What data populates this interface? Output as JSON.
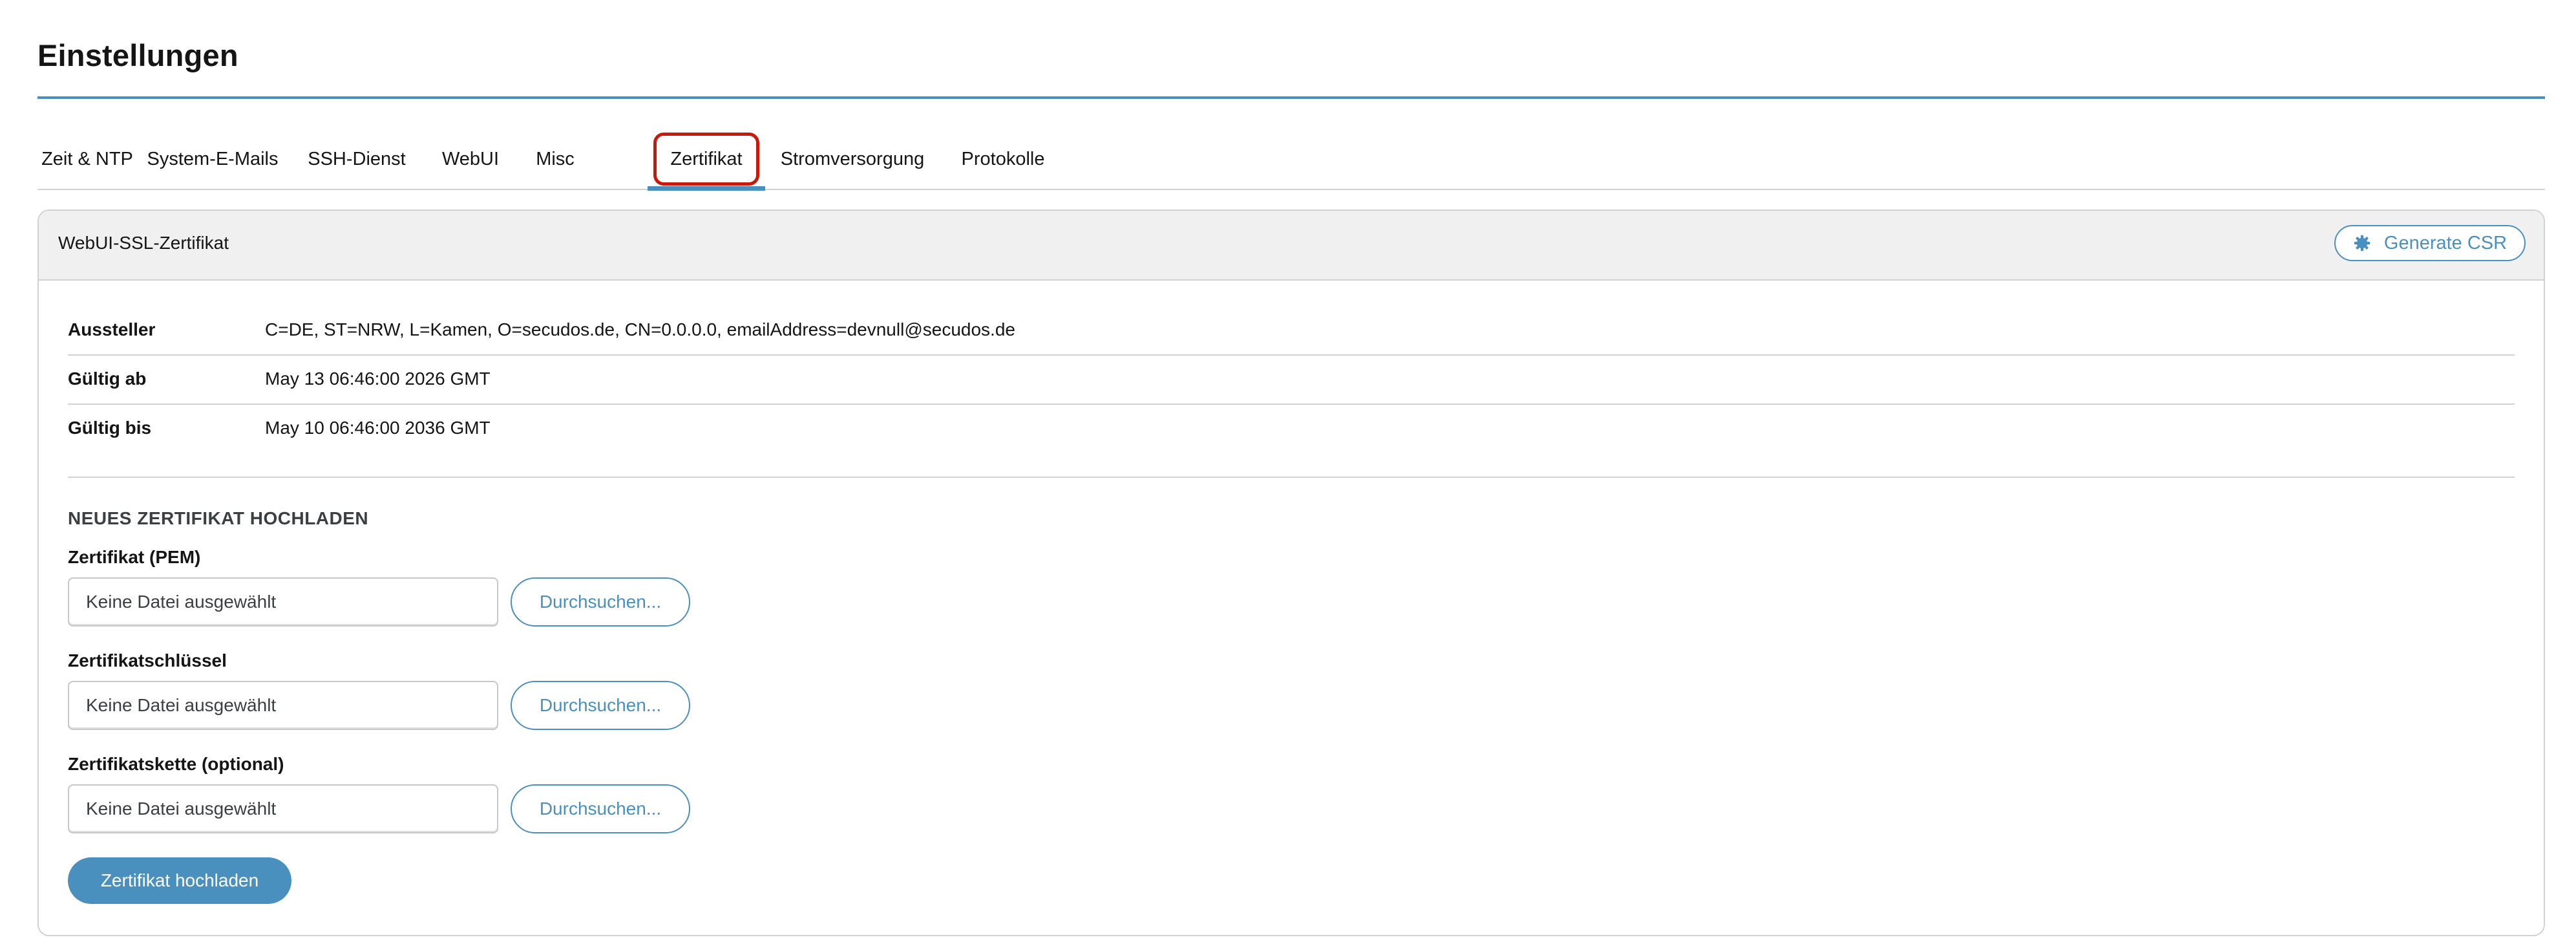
{
  "page": {
    "title": "Einstellungen"
  },
  "tabs": [
    {
      "label": "Zeit & NTP"
    },
    {
      "label": "System-E-Mails"
    },
    {
      "label": "SSH-Dienst"
    },
    {
      "label": "WebUI"
    },
    {
      "label": "Misc"
    },
    {
      "label": "Zertifikat",
      "active": true
    },
    {
      "label": "Stromversorgung"
    },
    {
      "label": "Protokolle"
    }
  ],
  "card": {
    "title": "WebUI-SSL-Zertifikat",
    "csr_button": {
      "label": "Generate CSR",
      "icon": "gear-icon"
    }
  },
  "certificate": {
    "issuer": {
      "label": "Aussteller",
      "value": "C=DE, ST=NRW, L=Kamen, O=secudos.de, CN=0.0.0.0, emailAddress=devnull@secudos.de"
    },
    "valid_from": {
      "label": "Gültig ab",
      "value": "May 13 06:46:00 2026 GMT"
    },
    "valid_to": {
      "label": "Gültig bis",
      "value": "May 10 06:46:00 2036 GMT"
    }
  },
  "upload": {
    "heading": "NEUES ZERTIFIKAT HOCHLADEN",
    "fields": [
      {
        "label": "Zertifikat (PEM)",
        "value": "Keine Datei ausgewählt",
        "button": "Durchsuchen..."
      },
      {
        "label": "Zertifikatschlüssel",
        "value": "Keine Datei ausgewählt",
        "button": "Durchsuchen..."
      },
      {
        "label": "Zertifikatskette (optional)",
        "value": "Keine Datei ausgewählt",
        "button": "Durchsuchen..."
      }
    ],
    "submit_label": "Zertifikat hochladen"
  },
  "colors": {
    "accent": "#4a90bf",
    "highlight": "#c9190b"
  }
}
